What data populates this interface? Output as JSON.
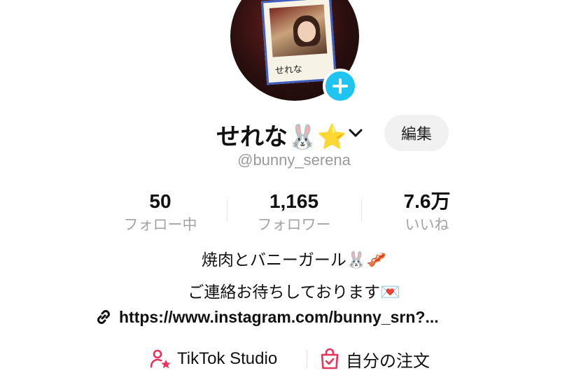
{
  "profile": {
    "display_name": "せれな🐰⭐",
    "handle": "@bunny_serena",
    "avatar_caption": "せれな",
    "edit_label": "編集"
  },
  "stats": [
    {
      "value": "50",
      "label": "フォロー中"
    },
    {
      "value": "1,165",
      "label": "フォロワー"
    },
    {
      "value": "7.6万",
      "label": "いいね"
    }
  ],
  "bio": {
    "line1": "焼肉とバニーガール🐰🥓",
    "line2": "ご連絡お待ちしております💌",
    "link": "https://www.instagram.com/bunny_srn?..."
  },
  "actions": {
    "studio_label": "TikTok Studio",
    "orders_label": "自分の注文"
  },
  "colors": {
    "accent_plus": "#20c4f0",
    "accent_red": "#e8335a",
    "muted_text": "#a3a3a3"
  },
  "icons": [
    "plus-icon",
    "chevron-down-icon",
    "link-icon",
    "person-star-icon",
    "shopping-bag-icon"
  ]
}
